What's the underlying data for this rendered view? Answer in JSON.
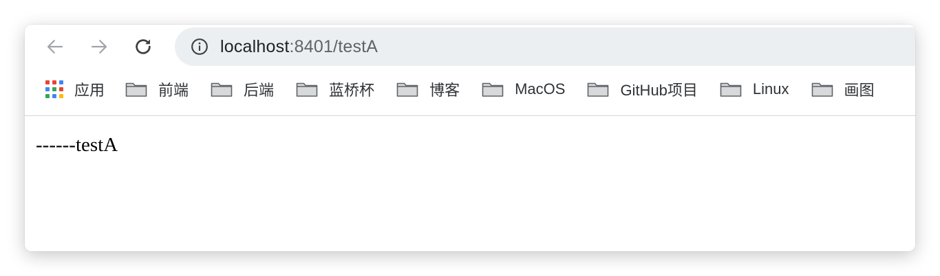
{
  "browser": {
    "url_host": "localhost",
    "url_path": ":8401/testA"
  },
  "icons": {
    "back": "back-arrow-icon",
    "forward": "forward-arrow-icon",
    "reload": "reload-icon",
    "info": "info-icon",
    "apps": "apps-grid-icon",
    "folder": "folder-icon"
  },
  "bookmarks": {
    "apps_label": "应用",
    "items": [
      {
        "label": "前端"
      },
      {
        "label": "后端"
      },
      {
        "label": "蓝桥杯"
      },
      {
        "label": "博客"
      },
      {
        "label": "MacOS"
      },
      {
        "label": "GitHub项目"
      },
      {
        "label": "Linux"
      },
      {
        "label": "画图"
      }
    ]
  },
  "page": {
    "text": "------testA"
  },
  "colors": {
    "omnibox_bg": "#eceff1",
    "nav_disabled": "#9aa0a6",
    "nav_enabled": "#3c4043",
    "apps_red": "#ea4335",
    "apps_blue": "#4285f4",
    "apps_green": "#34a853",
    "apps_yellow": "#fbbc05"
  }
}
